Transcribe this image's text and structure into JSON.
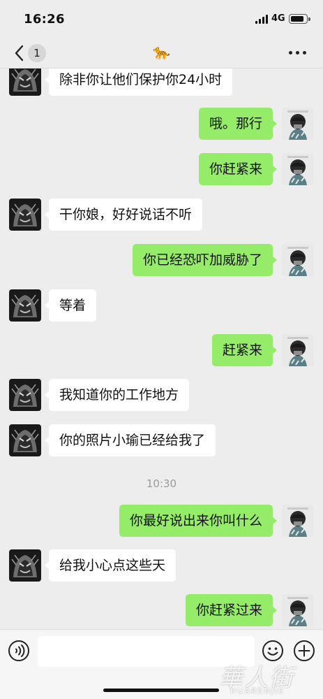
{
  "status_bar": {
    "time": "16:26",
    "network": "4G"
  },
  "header": {
    "unread_count": "1",
    "title": "🐆",
    "back_icon": "chevron-left-icon",
    "more_icon": "more-dots-icon"
  },
  "messages": [
    {
      "side": "in",
      "text": "除非你让他们保护你24小时"
    },
    {
      "side": "out",
      "text": "哦。那行"
    },
    {
      "side": "out",
      "text": "你赶紧来"
    },
    {
      "side": "in",
      "text": "干你娘，好好说话不听"
    },
    {
      "side": "out",
      "text": "你已经恐吓加威胁了"
    },
    {
      "side": "in",
      "text": "等着"
    },
    {
      "side": "out",
      "text": "赶紧来"
    },
    {
      "side": "in",
      "text": "我知道你的工作地方"
    },
    {
      "side": "in",
      "text": "你的照片小瑜已经给我了"
    },
    {
      "side": "out",
      "text": "你最好说出来你叫什么"
    },
    {
      "side": "in",
      "text": "给我小心点这些天"
    },
    {
      "side": "out",
      "text": "你赶紧过来"
    }
  ],
  "timestamp": "10:30",
  "input_bar": {
    "voice_icon": "voice-icon",
    "emoji_icon": "emoji-icon",
    "plus_icon": "plus-icon",
    "input_value": ""
  },
  "watermark": {
    "cjk": "華人街",
    "latin": "HUARENJIE"
  },
  "colors": {
    "background": "#ededed",
    "outgoing_bubble": "#95ec69",
    "incoming_bubble": "#ffffff",
    "timestamp_text": "#9a9a9a"
  }
}
